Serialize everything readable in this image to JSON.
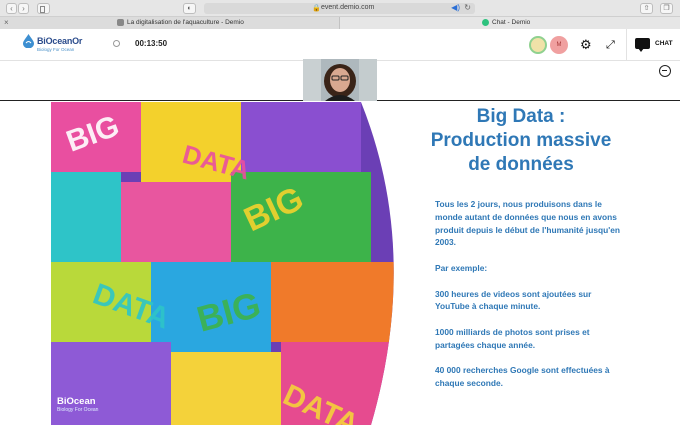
{
  "browser": {
    "url": "event.demio.com",
    "lock_glyph": "🔒",
    "tabs": [
      {
        "title": "La digitalisation de l'aquaculture - Demio"
      },
      {
        "title": "Chat - Demio"
      }
    ]
  },
  "header": {
    "logo_name": "BiOceanOr",
    "logo_tagline": "Biology For Ocean",
    "timer": "00:13:50",
    "chat_label": "CHAT",
    "avatar_2_initial": "M"
  },
  "slide": {
    "title_lines": [
      "Big Data :",
      "Production massive",
      "de données"
    ],
    "paragraphs": [
      "Tous les 2 jours, nous produisons dans le monde autant de données que nous en avons produit depuis le début de l'humanité jusqu'en 2003.",
      "Par exemple:",
      "300 heures de videos sont ajoutées sur YouTube à chaque minute.",
      "1000 milliards de photos sont prises et partagées chaque année.",
      "40 000 recherches Google sont effectuées à chaque seconde."
    ],
    "logo_name": "BiOcean",
    "logo_sub": "Biology For Ocean",
    "image_words": [
      "BIG",
      "DATA",
      "BIG",
      "DATA",
      "BIG",
      "DATA"
    ]
  },
  "colors": {
    "accent": "#2f78b6",
    "brand": "#2b4c8c"
  }
}
